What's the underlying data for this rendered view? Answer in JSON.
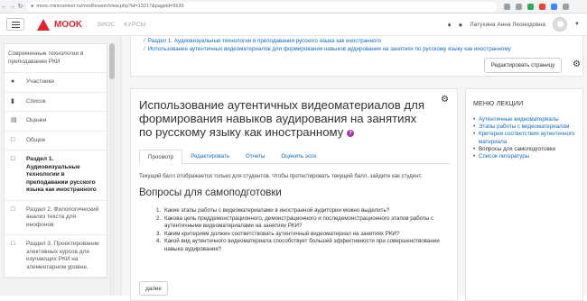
{
  "browser": {
    "url": "mooc.mininuniver.ru/mod/lesson/view.php?id=13217&pageid=5535"
  },
  "navbar": {
    "logo_text": "MOOK",
    "links": [
      "ЭИОС",
      "КУРСЫ"
    ],
    "user_name": "Латухина Анна Леонидовна"
  },
  "drawer": {
    "course_name": "Современные технологии в преподавании РКИ",
    "items": [
      {
        "icon": "users-icon",
        "label": "Участники"
      },
      {
        "icon": "badge-icon",
        "label": "Список"
      },
      {
        "icon": "grades-icon",
        "label": "Оценки"
      },
      {
        "icon": "folder-icon",
        "label": "Общее"
      },
      {
        "icon": "folder-icon",
        "label": "Раздел 1. Аудиовизуальные технологии в преподавании русского языка как иностранного",
        "active": true
      },
      {
        "icon": "folder-icon",
        "label": "Раздел 2. Филологический анализ текста для инофонов"
      },
      {
        "icon": "folder-icon",
        "label": "Раздел 3. Проектирование элективных курсов для изучающих РКИ на элементарном уровне."
      }
    ]
  },
  "breadcrumb": [
    "Раздел 1. Аудиовизуальные технологии в преподавании русского языка как иностранного",
    "Использование аутентичных видеоматериалов для формирования навыков аудирования на занятиях по русскому языку как иностранному"
  ],
  "edit_page_label": "Редактировать страницу",
  "lesson": {
    "title": "Использование аутентичных видеоматериалов для формирования навыков аудирования на занятиях по русскому языку как иностранному",
    "help_glyph": "?",
    "tabs": [
      "Просмотр",
      "Редактировать",
      "Отчеты",
      "Оценить эссе"
    ],
    "notice": "Текущий балл отображается только для студентов. Чтобы протестировать текущий балл, зайдите как студент.",
    "heading": "Вопросы для самоподготовки",
    "questions": [
      {
        "n": "1.",
        "text": "Какие этапы работы с видеоматериалами в иностранной аудитории можно выделить?"
      },
      {
        "n": "2.",
        "text": "Какова цель преддемонстрационного, демонстрационного и последемонстрационного этапов работы с аутентичными видеоматериалами на занятиях РКИ?"
      },
      {
        "n": "3.",
        "text": "Каким критериям должен соответствовать аутентичный видеоматериал на занятиях РКИ?"
      },
      {
        "n": "4.",
        "text": "Какой вид аутентичного видеоматериала способствует большей эффективности при совершенствовании навыка аудирования?"
      }
    ],
    "next_label": "далее"
  },
  "lesson_menu": {
    "title": "МЕНЮ ЛЕКЦИИ",
    "items": [
      {
        "label": "Аутентичные видеоматериалы"
      },
      {
        "label": "Этапы работы с видеоматериалом"
      },
      {
        "label": "Критерии соответствия аутентичного материала"
      },
      {
        "label": "Вопросы для самоподготовки",
        "current": true
      },
      {
        "label": "Список литературы"
      }
    ]
  }
}
